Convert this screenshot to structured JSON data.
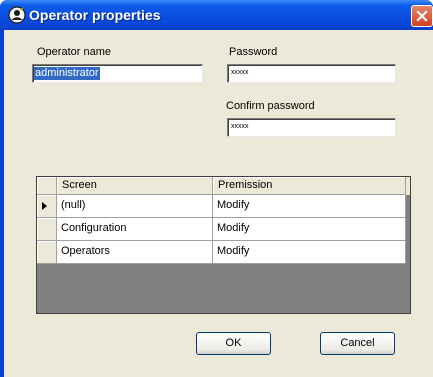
{
  "window": {
    "title": "Operator properties",
    "close_icon": "close-icon",
    "title_icon": "operator-icon"
  },
  "form": {
    "operator_name_label": "Operator name",
    "operator_name_value": "administrator",
    "password_label": "Password",
    "password_value": "xxxxx",
    "confirm_password_label": "Confirm password",
    "confirm_password_value": "xxxxx"
  },
  "grid": {
    "columns": [
      "Screen",
      "Premission"
    ],
    "rows": [
      {
        "screen": "(null)",
        "permission": "Modify",
        "current": true
      },
      {
        "screen": "Configuration",
        "permission": "Modify",
        "current": false
      },
      {
        "screen": "Operators",
        "permission": "Modify",
        "current": false
      }
    ],
    "current_row_icon": "arrow-right-icon"
  },
  "buttons": {
    "ok_label": "OK",
    "cancel_label": "Cancel"
  },
  "colors": {
    "titlebar": "#0a4ddf",
    "client_bg": "#ece9d8",
    "grid_bg": "#808080",
    "selection": "#316ac5",
    "close_button": "#d1411f"
  }
}
